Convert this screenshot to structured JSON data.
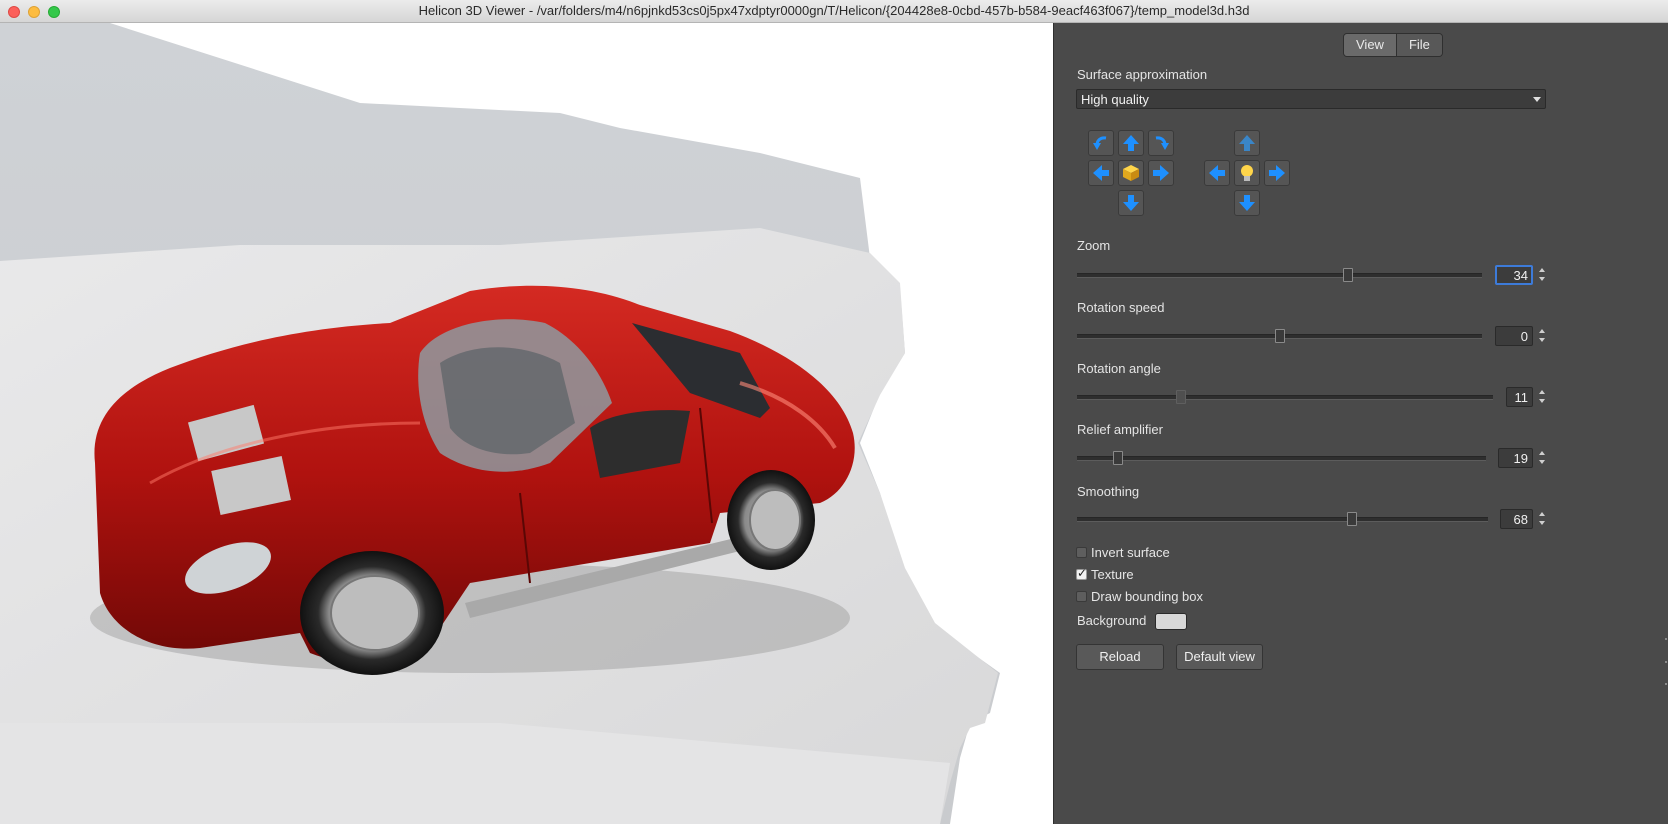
{
  "window": {
    "title": "Helicon 3D Viewer - /var/folders/m4/n6pjnkd53cs0j5px47xdptyr0000gn/T/Helicon/{204428e8-0cbd-457b-b584-9eacf463f067}/temp_model3d.h3d"
  },
  "tabs": [
    {
      "label": "View",
      "active": true
    },
    {
      "label": "File",
      "active": false
    }
  ],
  "surface": {
    "label": "Surface approximation",
    "value": "High quality"
  },
  "icons": {
    "view_controls": [
      "rotate-left-icon",
      "arrow-up-icon",
      "rotate-right-icon",
      "arrow-left-icon",
      "cube-icon",
      "arrow-right-icon",
      "arrow-down-icon"
    ],
    "light_controls": [
      "arrow-up-icon",
      "arrow-left-icon",
      "lightbulb-icon",
      "arrow-right-icon",
      "arrow-down-icon"
    ]
  },
  "sliders": {
    "zoom": {
      "label": "Zoom",
      "value": "34",
      "fraction": 0.67
    },
    "rotation_speed": {
      "label": "Rotation speed",
      "value": "0",
      "fraction": 0.5
    },
    "rotation_angle": {
      "label": "Rotation angle",
      "value": "11",
      "fraction": 0.25
    },
    "relief_amplifier": {
      "label": "Relief amplifier",
      "value": "19",
      "fraction": 0.1
    },
    "smoothing": {
      "label": "Smoothing",
      "value": "68",
      "fraction": 0.67
    }
  },
  "checkboxes": {
    "invert_surface": {
      "label": "Invert surface",
      "checked": false
    },
    "texture": {
      "label": "Texture",
      "checked": true
    },
    "draw_bounding_box": {
      "label": "Draw bounding box",
      "checked": false
    }
  },
  "background": {
    "label": "Background",
    "color": "#d8d8d8"
  },
  "buttons": {
    "reload": "Reload",
    "default_view": "Default view"
  },
  "colors": {
    "panel_bg": "#4a4a4a",
    "accent": "#3d7bd9",
    "arrow_blue": "#1e90ff",
    "car_red": "#b0120f"
  }
}
